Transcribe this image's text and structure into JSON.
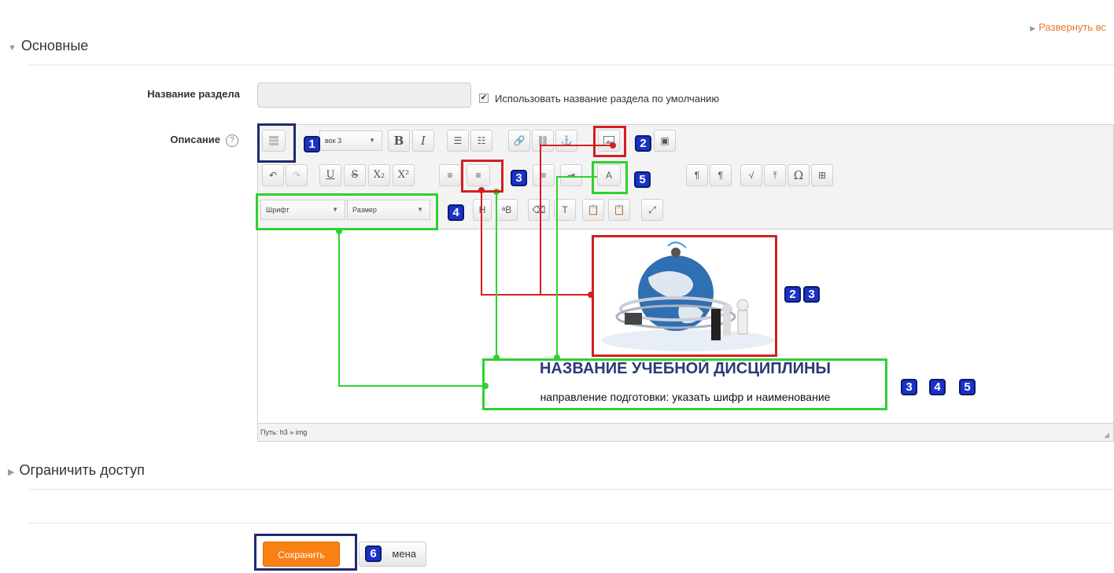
{
  "header": {
    "expand_all": "Развернуть вс"
  },
  "sections": {
    "general": "Основные",
    "restrict": "Ограничить доступ"
  },
  "form": {
    "section_name_label": "Название раздела",
    "section_name_value": "",
    "use_default_label": "Использовать название раздела по умолчанию",
    "use_default_checked": true,
    "description_label": "Описание"
  },
  "toolbar": {
    "row1": [
      "toggle-toolbar",
      "heading-select",
      "bold",
      "italic",
      "unordered-list",
      "ordered-list",
      "link",
      "unlink",
      "anchor",
      "image",
      "media"
    ],
    "heading_value": "вок 3",
    "bold": "B",
    "italic": "I",
    "underline": "U",
    "strike": "S",
    "subscript": "X₂",
    "superscript": "X²",
    "font_select": "Шрифт",
    "size_select": "Размер",
    "omega": "Ω"
  },
  "editor": {
    "heading": "НАЗВАНИЕ УЧЕБНОЙ ДИСЦИПЛИНЫ",
    "subtitle": "направление подготовки: указать шифр и наименование",
    "path": "Путь: h3 » img"
  },
  "buttons": {
    "save": "Сохранить",
    "cancel": "мена"
  },
  "badges": {
    "b1": "1",
    "b2": "2",
    "b3": "3",
    "b4": "4",
    "b5": "5",
    "b6": "6"
  },
  "colors": {
    "accent_orange": "#f98012",
    "link_orange": "#e4782a",
    "badge_blue": "#1a32c8",
    "callout_navy": "#1f2a6e",
    "callout_red": "#d42020",
    "callout_green": "#2fd12f"
  }
}
